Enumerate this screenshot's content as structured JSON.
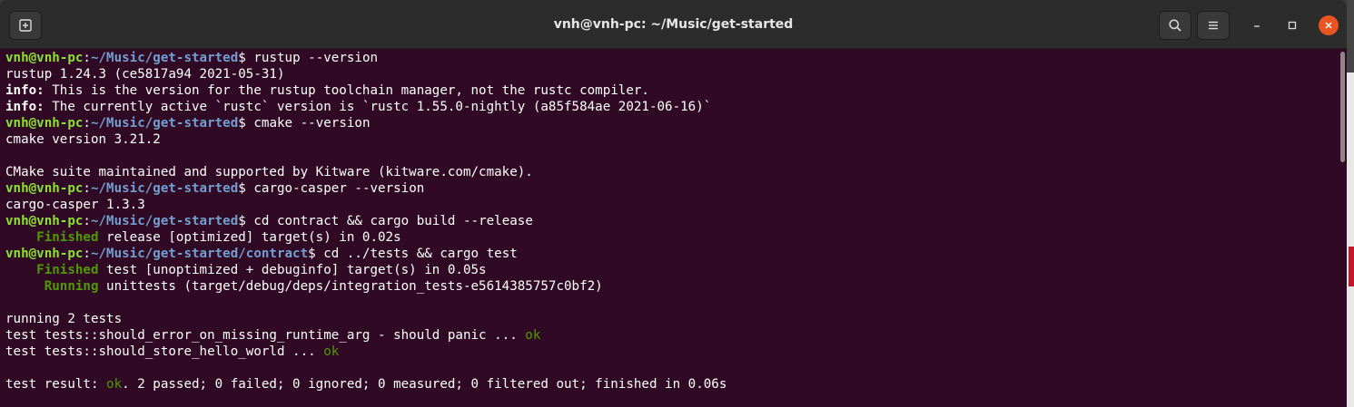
{
  "window": {
    "title": "vnh@vnh-pc: ~/Music/get-started"
  },
  "icons": {
    "new_tab": "new-tab-icon",
    "search": "search-icon",
    "menu": "hamburger-menu-icon",
    "minimize": "minimize-icon",
    "maximize": "maximize-icon",
    "close": "close-icon"
  },
  "colors": {
    "terminal_bg": "#300a24",
    "prompt_user": "#8ae234",
    "prompt_path": "#729fcf",
    "ok_green": "#4e9a06",
    "close_button": "#e95420"
  },
  "terminal": {
    "lines": [
      {
        "type": "prompt",
        "user": "vnh@vnh-pc",
        "sep": ":",
        "path": "~/Music/get-started",
        "dollar": "$ ",
        "cmd": "rustup --version"
      },
      {
        "type": "plain",
        "text": "rustup 1.24.3 (ce5817a94 2021-05-31)"
      },
      {
        "type": "bold-lead",
        "lead": "info:",
        "text": " This is the version for the rustup toolchain manager, not the rustc compiler."
      },
      {
        "type": "bold-lead",
        "lead": "info:",
        "text": " The currently active `rustc` version is `rustc 1.55.0-nightly (a85f584ae 2021-06-16)`"
      },
      {
        "type": "prompt",
        "user": "vnh@vnh-pc",
        "sep": ":",
        "path": "~/Music/get-started",
        "dollar": "$ ",
        "cmd": "cmake --version"
      },
      {
        "type": "plain",
        "text": "cmake version 3.21.2"
      },
      {
        "type": "plain",
        "text": ""
      },
      {
        "type": "plain",
        "text": "CMake suite maintained and supported by Kitware (kitware.com/cmake)."
      },
      {
        "type": "prompt",
        "user": "vnh@vnh-pc",
        "sep": ":",
        "path": "~/Music/get-started",
        "dollar": "$ ",
        "cmd": "cargo-casper --version"
      },
      {
        "type": "plain",
        "text": "cargo-casper 1.3.3"
      },
      {
        "type": "prompt",
        "user": "vnh@vnh-pc",
        "sep": ":",
        "path": "~/Music/get-started",
        "dollar": "$ ",
        "cmd": "cd contract && cargo build --release"
      },
      {
        "type": "green-lead",
        "indent": "    ",
        "lead": "Finished",
        "text": " release [optimized] target(s) in 0.02s"
      },
      {
        "type": "prompt",
        "user": "vnh@vnh-pc",
        "sep": ":",
        "path": "~/Music/get-started/contract",
        "dollar": "$ ",
        "cmd": "cd ../tests && cargo test"
      },
      {
        "type": "green-lead",
        "indent": "    ",
        "lead": "Finished",
        "text": " test [unoptimized + debuginfo] target(s) in 0.05s"
      },
      {
        "type": "green-lead",
        "indent": "     ",
        "lead": "Running",
        "text": " unittests (target/debug/deps/integration_tests-e5614385757c0bf2)"
      },
      {
        "type": "plain",
        "text": ""
      },
      {
        "type": "plain",
        "text": "running 2 tests"
      },
      {
        "type": "ok-tail",
        "text": "test tests::should_error_on_missing_runtime_arg - should panic ... ",
        "ok": "ok",
        "rest": ""
      },
      {
        "type": "ok-tail",
        "text": "test tests::should_store_hello_world ... ",
        "ok": "ok",
        "rest": ""
      },
      {
        "type": "plain",
        "text": ""
      },
      {
        "type": "ok-tail",
        "text": "test result: ",
        "ok": "ok",
        "rest": ". 2 passed; 0 failed; 0 ignored; 0 measured; 0 filtered out; finished in 0.06s"
      }
    ]
  }
}
